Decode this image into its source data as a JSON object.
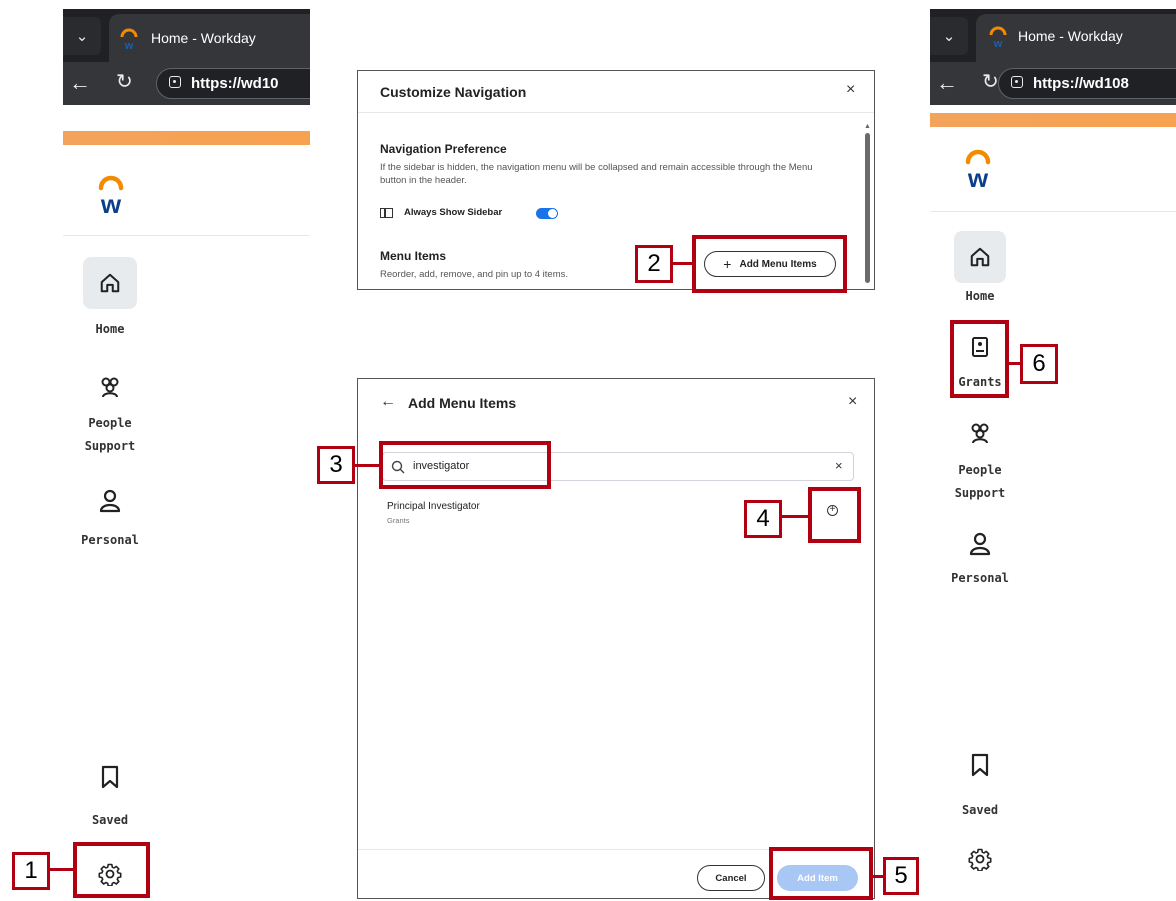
{
  "browser": {
    "tab_title": "Home - Workday",
    "url_left": "https://wd10",
    "url_right": "https://wd108"
  },
  "left_sidebar": {
    "items": [
      {
        "label": "Home"
      },
      {
        "label": "People\nSupport"
      },
      {
        "label": "Personal"
      }
    ],
    "saved_label": "Saved"
  },
  "customize_nav": {
    "title": "Customize Navigation",
    "pref_heading": "Navigation Preference",
    "pref_description": "If the sidebar is hidden, the navigation menu will be collapsed and remain accessible through the Menu button in the header.",
    "always_show_sidebar": "Always Show Sidebar",
    "always_show_sidebar_on": true,
    "menu_items_heading": "Menu Items",
    "menu_items_description": "Reorder, add, remove, and pin up to 4 items.",
    "add_menu_items_button": "Add Menu Items"
  },
  "add_menu_items": {
    "title": "Add Menu Items",
    "search_value": "investigator",
    "result_title": "Principal Investigator",
    "result_subtitle": "Grants",
    "cancel_button": "Cancel",
    "add_item_button": "Add Item"
  },
  "right_sidebar": {
    "items": [
      {
        "label": "Home"
      },
      {
        "label": "Grants"
      },
      {
        "label": "People\nSupport"
      },
      {
        "label": "Personal"
      }
    ],
    "saved_label": "Saved"
  },
  "callouts": [
    "1",
    "2",
    "3",
    "4",
    "5",
    "6"
  ],
  "colors": {
    "callout_red": "#b00012",
    "workday_blue": "#0b3f8c",
    "workday_orange": "#f38b00",
    "toggle_blue": "#1a73e8",
    "add_item_disabled": "#a8c7f5"
  },
  "icons": [
    "chevron-down-icon",
    "workday-logo-icon",
    "back-arrow-icon",
    "reload-icon",
    "lock-icon",
    "home-icon",
    "people-icon",
    "person-icon",
    "bookmark-icon",
    "gear-icon",
    "sidebar-icon",
    "plus-icon",
    "close-icon",
    "search-icon",
    "add-circle-icon",
    "grants-icon"
  ]
}
